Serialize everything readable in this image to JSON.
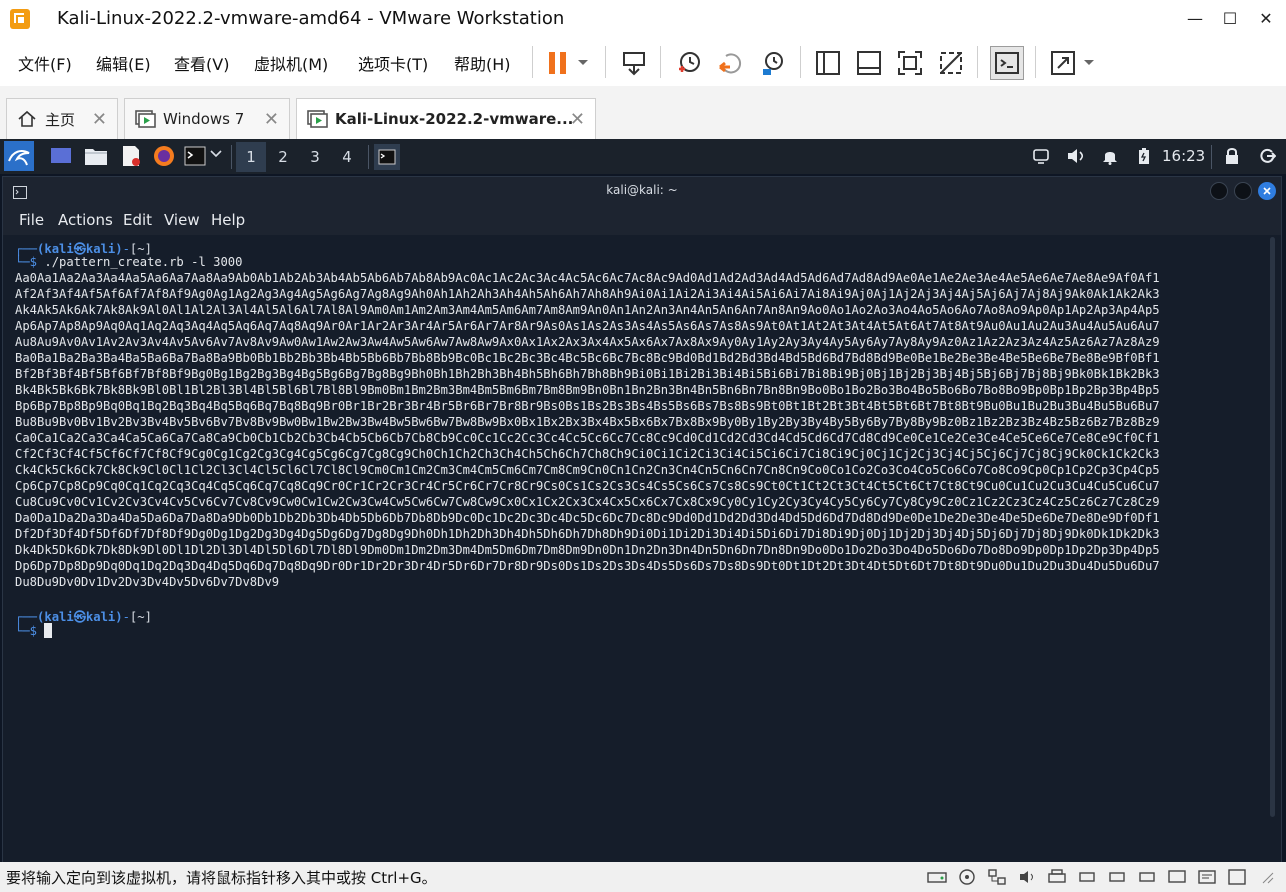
{
  "window": {
    "title": "Kali-Linux-2022.2-vmware-amd64 - VMware Workstation",
    "minimize": "—",
    "maximize": "☐",
    "close": "✕"
  },
  "menu": {
    "file": "文件(F)",
    "edit": "编辑(E)",
    "view": "查看(V)",
    "vm": "虚拟机(M)",
    "tabs": "选项卡(T)",
    "help": "帮助(H)"
  },
  "tabs": [
    {
      "label": "主页"
    },
    {
      "label": "Windows 7"
    },
    {
      "label": "Kali-Linux-2022.2-vmware..."
    }
  ],
  "panel": {
    "workspaces": [
      "1",
      "2",
      "3",
      "4"
    ],
    "clock": "16:23"
  },
  "terminal": {
    "title": "kali@kali: ~",
    "menu": [
      "File",
      "Actions",
      "Edit",
      "View",
      "Help"
    ],
    "prompt1_user": "(kali㉿kali)",
    "prompt_dir": "[~]",
    "command": "./pattern_create.rb -l 3000",
    "output_lines": [
      "Aa0Aa1Aa2Aa3Aa4Aa5Aa6Aa7Aa8Aa9Ab0Ab1Ab2Ab3Ab4Ab5Ab6Ab7Ab8Ab9Ac0Ac1Ac2Ac3Ac4Ac5Ac6Ac7Ac8Ac9Ad0Ad1Ad2Ad3Ad4Ad5Ad6Ad7Ad8Ad9Ae0Ae1Ae2Ae3Ae4Ae5Ae6Ae7Ae8Ae9Af0Af1",
      "Af2Af3Af4Af5Af6Af7Af8Af9Ag0Ag1Ag2Ag3Ag4Ag5Ag6Ag7Ag8Ag9Ah0Ah1Ah2Ah3Ah4Ah5Ah6Ah7Ah8Ah9Ai0Ai1Ai2Ai3Ai4Ai5Ai6Ai7Ai8Ai9Aj0Aj1Aj2Aj3Aj4Aj5Aj6Aj7Aj8Aj9Ak0Ak1Ak2Ak3",
      "Ak4Ak5Ak6Ak7Ak8Ak9Al0Al1Al2Al3Al4Al5Al6Al7Al8Al9Am0Am1Am2Am3Am4Am5Am6Am7Am8Am9An0An1An2An3An4An5An6An7An8An9Ao0Ao1Ao2Ao3Ao4Ao5Ao6Ao7Ao8Ao9Ap0Ap1Ap2Ap3Ap4Ap5",
      "Ap6Ap7Ap8Ap9Aq0Aq1Aq2Aq3Aq4Aq5Aq6Aq7Aq8Aq9Ar0Ar1Ar2Ar3Ar4Ar5Ar6Ar7Ar8Ar9As0As1As2As3As4As5As6As7As8As9At0At1At2At3At4At5At6At7At8At9Au0Au1Au2Au3Au4Au5Au6Au7",
      "Au8Au9Av0Av1Av2Av3Av4Av5Av6Av7Av8Av9Aw0Aw1Aw2Aw3Aw4Aw5Aw6Aw7Aw8Aw9Ax0Ax1Ax2Ax3Ax4Ax5Ax6Ax7Ax8Ax9Ay0Ay1Ay2Ay3Ay4Ay5Ay6Ay7Ay8Ay9Az0Az1Az2Az3Az4Az5Az6Az7Az8Az9",
      "Ba0Ba1Ba2Ba3Ba4Ba5Ba6Ba7Ba8Ba9Bb0Bb1Bb2Bb3Bb4Bb5Bb6Bb7Bb8Bb9Bc0Bc1Bc2Bc3Bc4Bc5Bc6Bc7Bc8Bc9Bd0Bd1Bd2Bd3Bd4Bd5Bd6Bd7Bd8Bd9Be0Be1Be2Be3Be4Be5Be6Be7Be8Be9Bf0Bf1",
      "Bf2Bf3Bf4Bf5Bf6Bf7Bf8Bf9Bg0Bg1Bg2Bg3Bg4Bg5Bg6Bg7Bg8Bg9Bh0Bh1Bh2Bh3Bh4Bh5Bh6Bh7Bh8Bh9Bi0Bi1Bi2Bi3Bi4Bi5Bi6Bi7Bi8Bi9Bj0Bj1Bj2Bj3Bj4Bj5Bj6Bj7Bj8Bj9Bk0Bk1Bk2Bk3",
      "Bk4Bk5Bk6Bk7Bk8Bk9Bl0Bl1Bl2Bl3Bl4Bl5Bl6Bl7Bl8Bl9Bm0Bm1Bm2Bm3Bm4Bm5Bm6Bm7Bm8Bm9Bn0Bn1Bn2Bn3Bn4Bn5Bn6Bn7Bn8Bn9Bo0Bo1Bo2Bo3Bo4Bo5Bo6Bo7Bo8Bo9Bp0Bp1Bp2Bp3Bp4Bp5",
      "Bp6Bp7Bp8Bp9Bq0Bq1Bq2Bq3Bq4Bq5Bq6Bq7Bq8Bq9Br0Br1Br2Br3Br4Br5Br6Br7Br8Br9Bs0Bs1Bs2Bs3Bs4Bs5Bs6Bs7Bs8Bs9Bt0Bt1Bt2Bt3Bt4Bt5Bt6Bt7Bt8Bt9Bu0Bu1Bu2Bu3Bu4Bu5Bu6Bu7",
      "Bu8Bu9Bv0Bv1Bv2Bv3Bv4Bv5Bv6Bv7Bv8Bv9Bw0Bw1Bw2Bw3Bw4Bw5Bw6Bw7Bw8Bw9Bx0Bx1Bx2Bx3Bx4Bx5Bx6Bx7Bx8Bx9By0By1By2By3By4By5By6By7By8By9Bz0Bz1Bz2Bz3Bz4Bz5Bz6Bz7Bz8Bz9",
      "Ca0Ca1Ca2Ca3Ca4Ca5Ca6Ca7Ca8Ca9Cb0Cb1Cb2Cb3Cb4Cb5Cb6Cb7Cb8Cb9Cc0Cc1Cc2Cc3Cc4Cc5Cc6Cc7Cc8Cc9Cd0Cd1Cd2Cd3Cd4Cd5Cd6Cd7Cd8Cd9Ce0Ce1Ce2Ce3Ce4Ce5Ce6Ce7Ce8Ce9Cf0Cf1",
      "Cf2Cf3Cf4Cf5Cf6Cf7Cf8Cf9Cg0Cg1Cg2Cg3Cg4Cg5Cg6Cg7Cg8Cg9Ch0Ch1Ch2Ch3Ch4Ch5Ch6Ch7Ch8Ch9Ci0Ci1Ci2Ci3Ci4Ci5Ci6Ci7Ci8Ci9Cj0Cj1Cj2Cj3Cj4Cj5Cj6Cj7Cj8Cj9Ck0Ck1Ck2Ck3",
      "Ck4Ck5Ck6Ck7Ck8Ck9Cl0Cl1Cl2Cl3Cl4Cl5Cl6Cl7Cl8Cl9Cm0Cm1Cm2Cm3Cm4Cm5Cm6Cm7Cm8Cm9Cn0Cn1Cn2Cn3Cn4Cn5Cn6Cn7Cn8Cn9Co0Co1Co2Co3Co4Co5Co6Co7Co8Co9Cp0Cp1Cp2Cp3Cp4Cp5",
      "Cp6Cp7Cp8Cp9Cq0Cq1Cq2Cq3Cq4Cq5Cq6Cq7Cq8Cq9Cr0Cr1Cr2Cr3Cr4Cr5Cr6Cr7Cr8Cr9Cs0Cs1Cs2Cs3Cs4Cs5Cs6Cs7Cs8Cs9Ct0Ct1Ct2Ct3Ct4Ct5Ct6Ct7Ct8Ct9Cu0Cu1Cu2Cu3Cu4Cu5Cu6Cu7",
      "Cu8Cu9Cv0Cv1Cv2Cv3Cv4Cv5Cv6Cv7Cv8Cv9Cw0Cw1Cw2Cw3Cw4Cw5Cw6Cw7Cw8Cw9Cx0Cx1Cx2Cx3Cx4Cx5Cx6Cx7Cx8Cx9Cy0Cy1Cy2Cy3Cy4Cy5Cy6Cy7Cy8Cy9Cz0Cz1Cz2Cz3Cz4Cz5Cz6Cz7Cz8Cz9",
      "Da0Da1Da2Da3Da4Da5Da6Da7Da8Da9Db0Db1Db2Db3Db4Db5Db6Db7Db8Db9Dc0Dc1Dc2Dc3Dc4Dc5Dc6Dc7Dc8Dc9Dd0Dd1Dd2Dd3Dd4Dd5Dd6Dd7Dd8Dd9De0De1De2De3De4De5De6De7De8De9Df0Df1",
      "Df2Df3Df4Df5Df6Df7Df8Df9Dg0Dg1Dg2Dg3Dg4Dg5Dg6Dg7Dg8Dg9Dh0Dh1Dh2Dh3Dh4Dh5Dh6Dh7Dh8Dh9Di0Di1Di2Di3Di4Di5Di6Di7Di8Di9Dj0Dj1Dj2Dj3Dj4Dj5Dj6Dj7Dj8Dj9Dk0Dk1Dk2Dk3",
      "Dk4Dk5Dk6Dk7Dk8Dk9Dl0Dl1Dl2Dl3Dl4Dl5Dl6Dl7Dl8Dl9Dm0Dm1Dm2Dm3Dm4Dm5Dm6Dm7Dm8Dm9Dn0Dn1Dn2Dn3Dn4Dn5Dn6Dn7Dn8Dn9Do0Do1Do2Do3Do4Do5Do6Do7Do8Do9Dp0Dp1Dp2Dp3Dp4Dp5",
      "Dp6Dp7Dp8Dp9Dq0Dq1Dq2Dq3Dq4Dq5Dq6Dq7Dq8Dq9Dr0Dr1Dr2Dr3Dr4Dr5Dr6Dr7Dr8Dr9Ds0Ds1Ds2Ds3Ds4Ds5Ds6Ds7Ds8Ds9Dt0Dt1Dt2Dt3Dt4Dt5Dt6Dt7Dt8Dt9Du0Du1Du2Du3Du4Du5Du6Du7",
      "Du8Du9Dv0Dv1Dv2Dv3Dv4Dv5Dv6Dv7Dv8Dv9"
    ]
  },
  "status": {
    "message": "要将输入定向到该虚拟机，请将鼠标指针移入其中或按 Ctrl+G。"
  },
  "colors": {
    "terminal_bg": "#151d2a",
    "prompt_blue": "#4c8fe6",
    "pause_orange": "#f0711c",
    "vmware_accent": "#1a8f3c"
  }
}
